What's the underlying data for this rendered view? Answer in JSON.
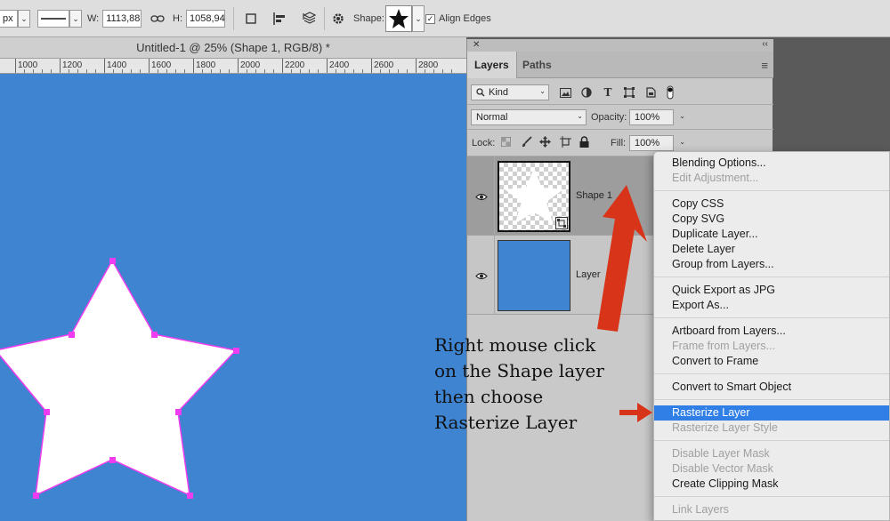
{
  "options_bar": {
    "unit": "px",
    "width_label": "W:",
    "width_value": "1113,88",
    "height_label": "H:",
    "height_value": "1058,94",
    "shape_label": "Shape:",
    "align_edges_label": "Align Edges",
    "align_edges_checked": true
  },
  "document": {
    "title": "Untitled-1 @ 25% (Shape 1, RGB/8) *",
    "ruler_labels": [
      "1000",
      "1200",
      "1400",
      "1600",
      "1800",
      "2000",
      "2200",
      "2400",
      "2600",
      "2800"
    ],
    "canvas_color": "#3e84d0"
  },
  "layers_panel": {
    "tabs": [
      "Layers",
      "Paths"
    ],
    "filter_kind": "Kind",
    "blend_mode": "Normal",
    "opacity_label": "Opacity:",
    "opacity_value": "100%",
    "lock_label": "Lock:",
    "fill_label": "Fill:",
    "fill_value": "100%",
    "layers": [
      {
        "name": "Shape 1",
        "selected": true
      },
      {
        "name": "Layer",
        "selected": false
      }
    ]
  },
  "context_menu": {
    "groups": [
      [
        {
          "label": "Blending Options...",
          "enabled": true
        },
        {
          "label": "Edit Adjustment...",
          "enabled": false
        }
      ],
      [
        {
          "label": "Copy CSS",
          "enabled": true
        },
        {
          "label": "Copy SVG",
          "enabled": true
        },
        {
          "label": "Duplicate Layer...",
          "enabled": true
        },
        {
          "label": "Delete Layer",
          "enabled": true
        },
        {
          "label": "Group from Layers...",
          "enabled": true
        }
      ],
      [
        {
          "label": "Quick Export as JPG",
          "enabled": true
        },
        {
          "label": "Export As...",
          "enabled": true
        }
      ],
      [
        {
          "label": "Artboard from Layers...",
          "enabled": true
        },
        {
          "label": "Frame from Layers...",
          "enabled": false
        },
        {
          "label": "Convert to Frame",
          "enabled": true
        }
      ],
      [
        {
          "label": "Convert to Smart Object",
          "enabled": true
        }
      ],
      [
        {
          "label": "Rasterize Layer",
          "enabled": true,
          "highlighted": true
        },
        {
          "label": "Rasterize Layer Style",
          "enabled": false
        }
      ],
      [
        {
          "label": "Disable Layer Mask",
          "enabled": false
        },
        {
          "label": "Disable Vector Mask",
          "enabled": false
        },
        {
          "label": "Create Clipping Mask",
          "enabled": true
        }
      ],
      [
        {
          "label": "Link Layers",
          "enabled": false
        }
      ]
    ],
    "highlight_color": "#2f7fe6"
  },
  "annotation": {
    "text": "Right mouse click\non the Shape layer\nthen choose\nRasterize Layer",
    "arrow_color": "#d8341a"
  }
}
